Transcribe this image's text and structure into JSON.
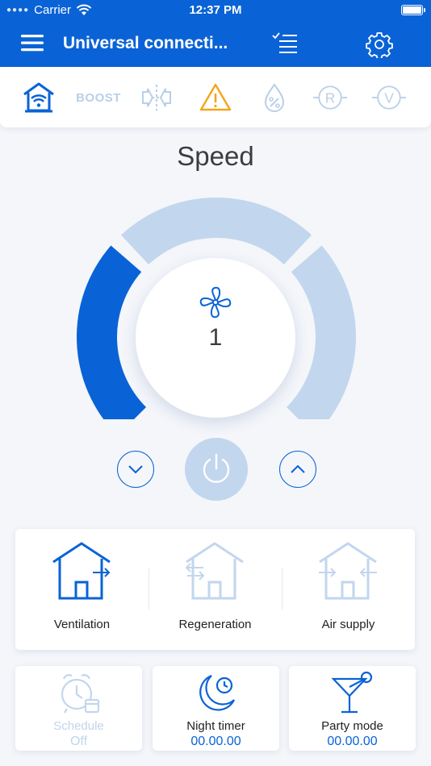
{
  "status_bar": {
    "carrier": "Carrier",
    "time": "12:37 PM"
  },
  "nav": {
    "title": "Universal connecti..."
  },
  "modes": {
    "boost_label": "BOOST"
  },
  "speed": {
    "title": "Speed",
    "value": "1",
    "level": 1,
    "max_level": 3
  },
  "ventilation_modes": [
    {
      "label": "Ventilation",
      "active": true
    },
    {
      "label": "Regeneration",
      "active": false
    },
    {
      "label": "Air supply",
      "active": false
    }
  ],
  "timers": {
    "schedule": {
      "label": "Schedule",
      "value": "Off",
      "enabled": false
    },
    "night_timer": {
      "label": "Night timer",
      "value": "00.00.00",
      "enabled": true
    },
    "party_mode": {
      "label": "Party mode",
      "value": "00.00.00",
      "enabled": true
    }
  },
  "colors": {
    "primary": "#0a63d6",
    "inactive": "#c2d6ee",
    "warning": "#f2a51a",
    "background": "#f4f6fa"
  }
}
